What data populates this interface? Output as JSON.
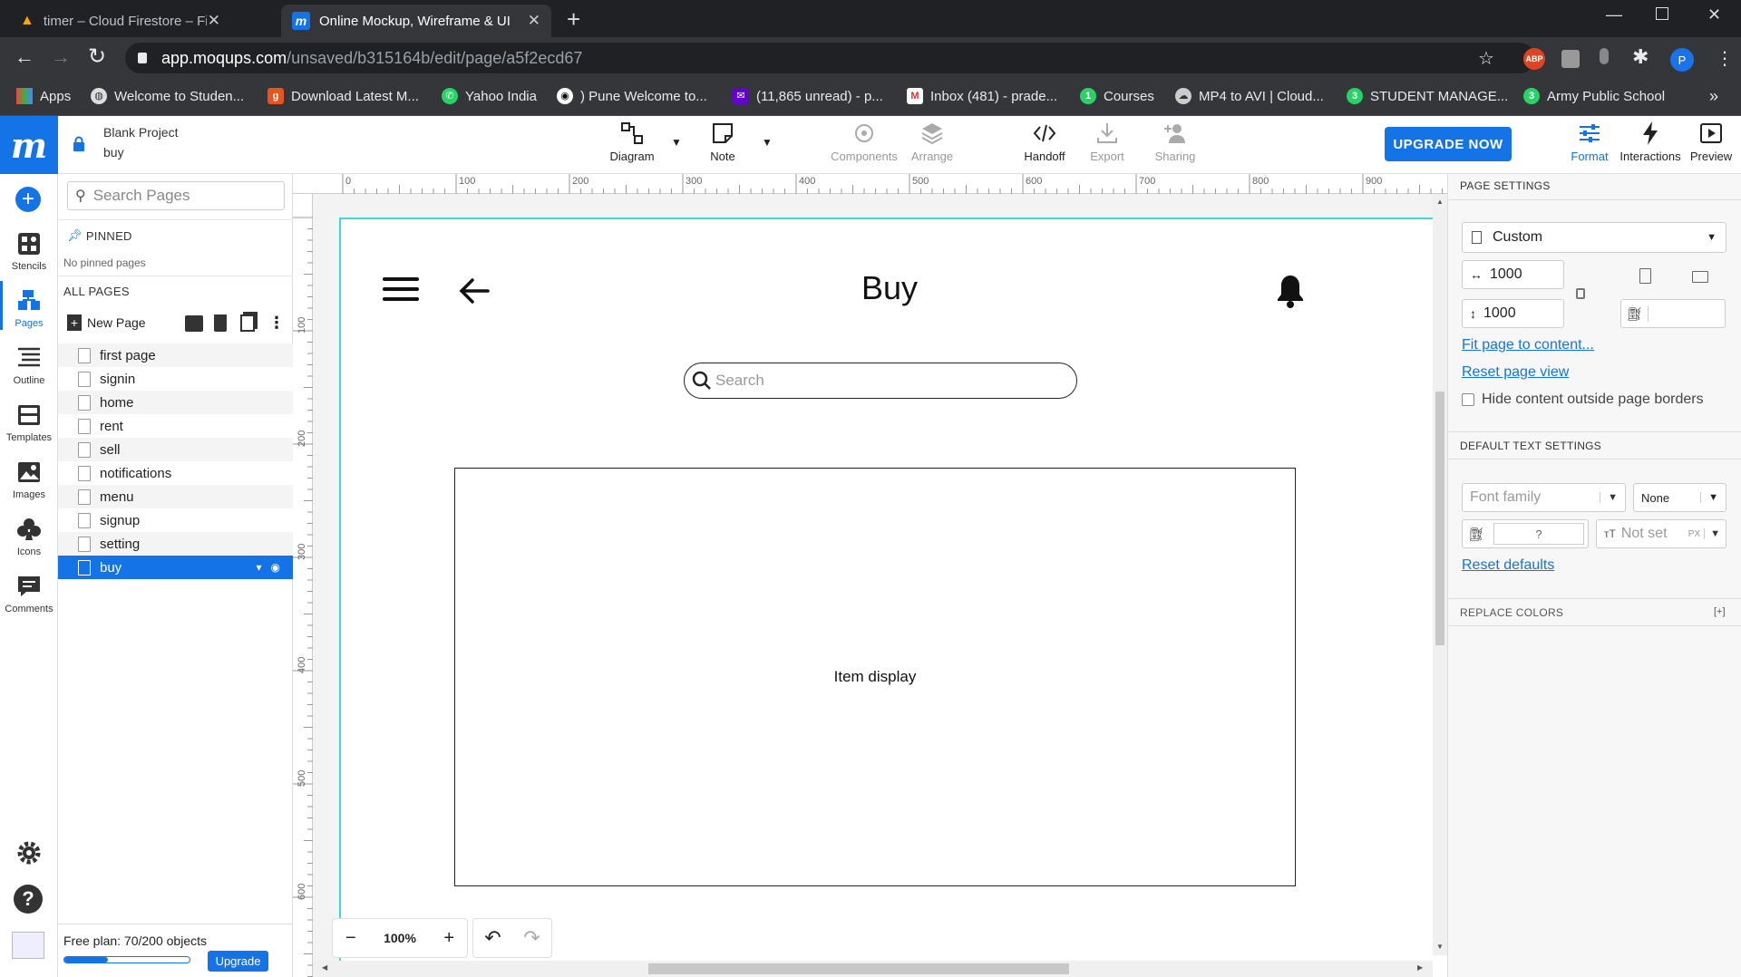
{
  "browser": {
    "tabs": [
      {
        "title": "timer – Cloud Firestore – Firebas"
      },
      {
        "title": "Online Mockup, Wireframe & UI"
      }
    ],
    "url_host": "app.moqups.com",
    "url_path": "/unsaved/b315164b/edit/page/a5f2ecd67",
    "bookmarks": [
      {
        "label": "Apps",
        "icon": "apps-grid-icon"
      },
      {
        "label": "Welcome to Studen...",
        "icon": "globe-icon"
      },
      {
        "label": "Download Latest M...",
        "icon": "g-icon"
      },
      {
        "label": "Yahoo India",
        "icon": "whatsapp-icon"
      },
      {
        "label": ") Pune Welcome to...",
        "icon": "github-icon"
      },
      {
        "label": "(11,865 unread) - p...",
        "icon": "yahoo-mail-icon"
      },
      {
        "label": "Inbox (481) - prade...",
        "icon": "gmail-icon"
      },
      {
        "label": "Courses",
        "icon": "whatsapp-icon"
      },
      {
        "label": "MP4 to AVI | Cloud...",
        "icon": "cloud-icon"
      },
      {
        "label": "STUDENT MANAGE...",
        "icon": "whatsapp-icon"
      },
      {
        "label": "Army Public School",
        "icon": "whatsapp-icon"
      }
    ],
    "more_bookmarks": "»",
    "profile_initial": "P",
    "abp_label": "ABP"
  },
  "header": {
    "project_name": "Blank Project",
    "page_name": "buy",
    "tools": [
      {
        "label": "Diagram"
      },
      {
        "label": "Note"
      },
      {
        "label": "Components"
      },
      {
        "label": "Arrange"
      },
      {
        "label": "Handoff"
      },
      {
        "label": "Export"
      },
      {
        "label": "Sharing"
      }
    ],
    "upgrade_label": "UPGRADE NOW",
    "right_tools": [
      {
        "label": "Format"
      },
      {
        "label": "Interactions"
      },
      {
        "label": "Preview"
      }
    ]
  },
  "rail": {
    "items": [
      {
        "label": "Stencils"
      },
      {
        "label": "Pages"
      },
      {
        "label": "Outline"
      },
      {
        "label": "Templates"
      },
      {
        "label": "Images"
      },
      {
        "label": "Icons"
      },
      {
        "label": "Comments"
      }
    ]
  },
  "pages_panel": {
    "search_placeholder": "Search Pages",
    "pinned_title": "PINNED",
    "no_pinned": "No pinned pages",
    "all_pages_title": "ALL PAGES",
    "new_page_label": "New Page",
    "pages": [
      "first page",
      "signin",
      "home",
      "rent",
      "sell",
      "notifications",
      "menu",
      "signup",
      "setting",
      "buy"
    ],
    "selected_page": "buy",
    "plan_text": "Free plan: 70/200 objects",
    "plan_usage": 0.35,
    "upgrade_label": "Upgrade"
  },
  "ruler": {
    "h_ticks": [
      "0",
      "100",
      "200",
      "300",
      "400",
      "500",
      "600",
      "700",
      "800",
      "900"
    ],
    "v_ticks": [
      "100",
      "200",
      "300",
      "400",
      "500",
      "600"
    ]
  },
  "mockup": {
    "title": "Buy",
    "search_placeholder": "Search",
    "item_display_label": "Item display"
  },
  "zoom": {
    "minus": "−",
    "value": "100%",
    "plus": "+"
  },
  "right_panel": {
    "page_settings_title": "PAGE SETTINGS",
    "page_size_preset": "Custom",
    "width": "1000",
    "height": "1000",
    "fit_link": "Fit page to content...",
    "reset_link": "Reset page view",
    "hide_outside_label": "Hide content outside page borders",
    "text_settings_title": "DEFAULT TEXT SETTINGS",
    "font_family_placeholder": "Font family",
    "font_weight_value": "None",
    "color_value": "?",
    "size_placeholder": "Not set",
    "size_unit": "PX",
    "reset_defaults_link": "Reset defaults",
    "replace_colors_title": "REPLACE COLORS",
    "replace_colors_toggle": "[+]"
  },
  "colors": {
    "accent": "#1473e6",
    "chrome_dark": "#202124",
    "page_border": "#3fd6e0"
  }
}
